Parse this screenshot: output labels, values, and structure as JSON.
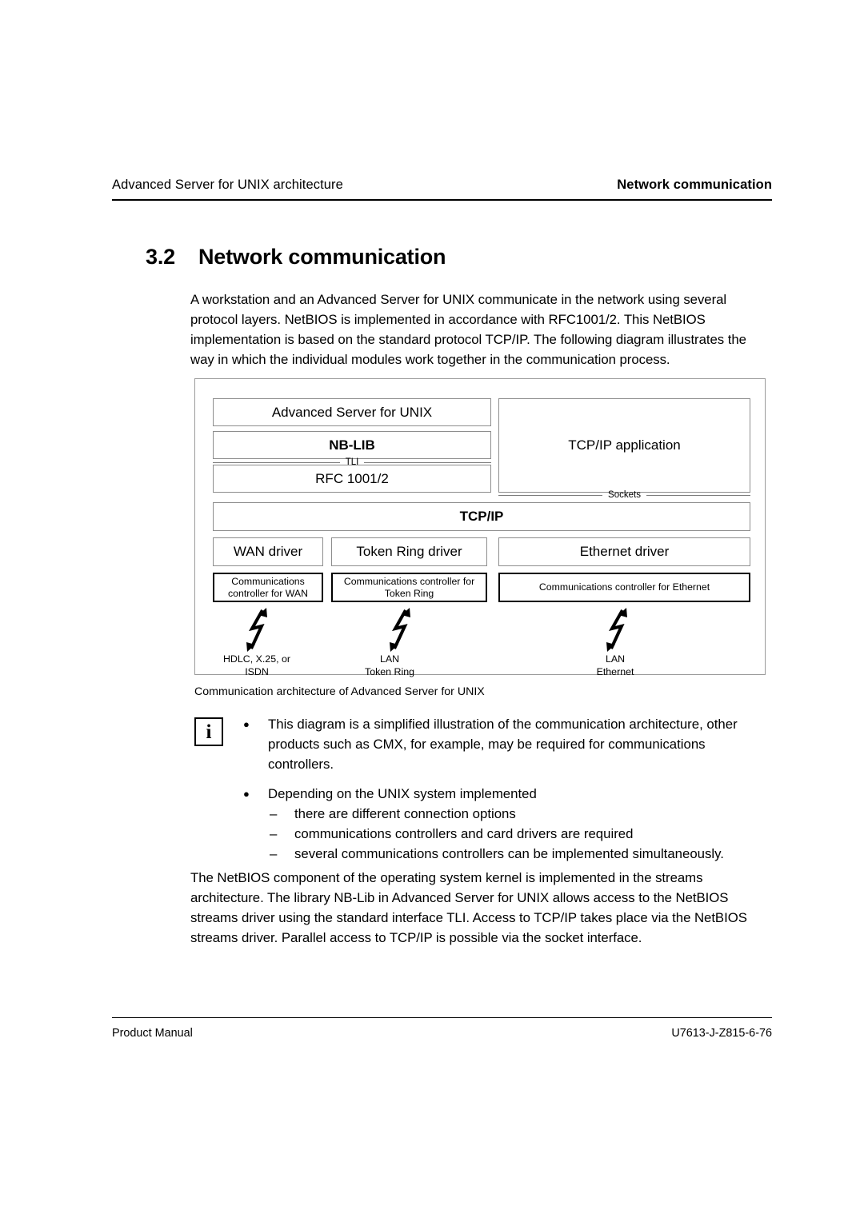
{
  "header": {
    "left": "Advanced Server for UNIX architecture",
    "right": "Network communication"
  },
  "section": {
    "number": "3.2",
    "title": "Network communication"
  },
  "intro_paragraph": "A workstation and an Advanced Server for UNIX communicate in the network using several protocol layers. NetBIOS is implemented in accordance with RFC1001/2. This NetBIOS implementation is based on the standard protocol TCP/IP. The following diagram illustrates the way in which the individual modules work together in the communication process.",
  "diagram": {
    "boxes": {
      "advanced_server": "Advanced Server for UNIX",
      "nb_lib": "NB-LIB",
      "rfc": "RFC 1001/2",
      "tcpip_application": "TCP/IP application",
      "tcpip": "TCP/IP",
      "wan_driver": "WAN driver",
      "token_ring_driver": "Token Ring driver",
      "ethernet_driver": "Ethernet driver",
      "wan_controller": "Communications controller for WAN",
      "token_ring_controller": "Communications controller for Token Ring",
      "ethernet_controller": "Communications controller for Ethernet"
    },
    "interfaces": {
      "tli": "TLI",
      "sockets": "Sockets"
    },
    "media_labels": {
      "wan": "HDLC, X.25, or\nISDN",
      "token_ring": "LAN\nToken Ring",
      "ethernet": "LAN\nEthernet"
    },
    "caption": "Communication architecture of Advanced Server for UNIX"
  },
  "note": {
    "icon": "i",
    "bullet_glyph": "●",
    "dash_glyph": "–",
    "items": [
      "This diagram is a simplified illustration of the communication architecture, other products such as CMX, for example, may be required for communications controllers.",
      "Depending on the UNIX system implemented"
    ],
    "sub_items": [
      "there are different connection options",
      "communications controllers and card drivers are required",
      "several communications controllers can be implemented simultaneously."
    ]
  },
  "closing_paragraph": "The NetBIOS component of the operating system kernel is implemented in the streams architecture. The library NB-Lib in Advanced Server for UNIX allows access to the NetBIOS streams driver using the standard interface TLI. Access to TCP/IP takes place via the NetBIOS streams driver. Parallel access to TCP/IP is possible via the socket interface.",
  "footer": {
    "left": "Product Manual",
    "right": "U7613-J-Z815-6-76"
  }
}
